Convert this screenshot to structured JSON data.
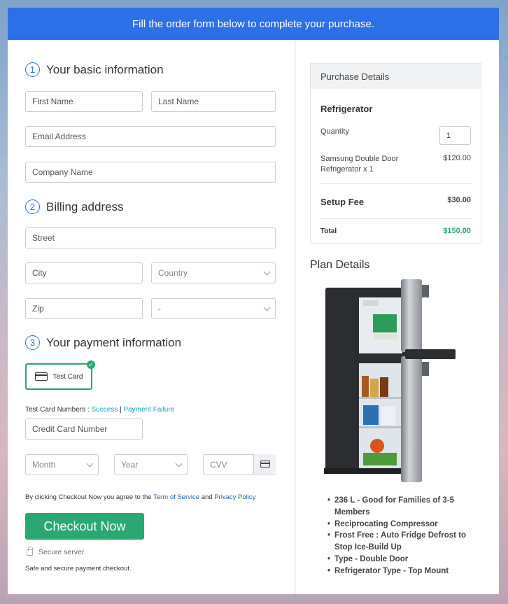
{
  "banner": "Fill the order form below to complete your purchase.",
  "steps": [
    {
      "num": "1",
      "title": "Your basic information"
    },
    {
      "num": "2",
      "title": "Billing address"
    },
    {
      "num": "3",
      "title": "Your payment information"
    }
  ],
  "basic": {
    "first_name": "First Name",
    "last_name": "Last Name",
    "email": "Email Address",
    "company": "Company Name"
  },
  "billing": {
    "street": "Street",
    "city": "City",
    "country": "Country",
    "zip": "Zip",
    "state": "-"
  },
  "payment": {
    "test_card_label": "Test Card",
    "test_numbers_label": "Test Card Numbers :",
    "success_link": "Success",
    "separator": "|",
    "failure_link": "Payment Failure",
    "card_number": "Credit Card Number",
    "month": "Month",
    "year": "Year",
    "cvv": "CVV"
  },
  "terms": {
    "prefix": "By clicking Checkout Now you agree to the",
    "tos": "Term of Service",
    "and": "and",
    "privacy": "Privacy Policy"
  },
  "checkout_button": "Checkout Now",
  "secure_server": "Secure server",
  "safe_text": "Safe and secure payment checkout.",
  "purchase": {
    "header": "Purchase Details",
    "product": "Refrigerator",
    "quantity_label": "Quantity",
    "quantity_value": "1",
    "item_name_line1": "Samsung Double Door",
    "item_name_line2": "Refrigerator x 1",
    "item_price": "$120.00",
    "setup_label": "Setup Fee",
    "setup_price": "$30.00",
    "total_label": "Total",
    "total_price": "$150.00"
  },
  "plan": {
    "title": "Plan Details",
    "features": [
      "236 L - Good for Families of 3-5 Members",
      "Reciprocating Compressor",
      "Frost Free : Auto Fridge Defrost to Stop Ice-Build Up",
      "Type - Double Door",
      "Refrigerator Type - Top Mount"
    ]
  },
  "colors": {
    "accent": "#2d6fe6",
    "success": "#2aa772",
    "total_green": "#2aa772"
  }
}
